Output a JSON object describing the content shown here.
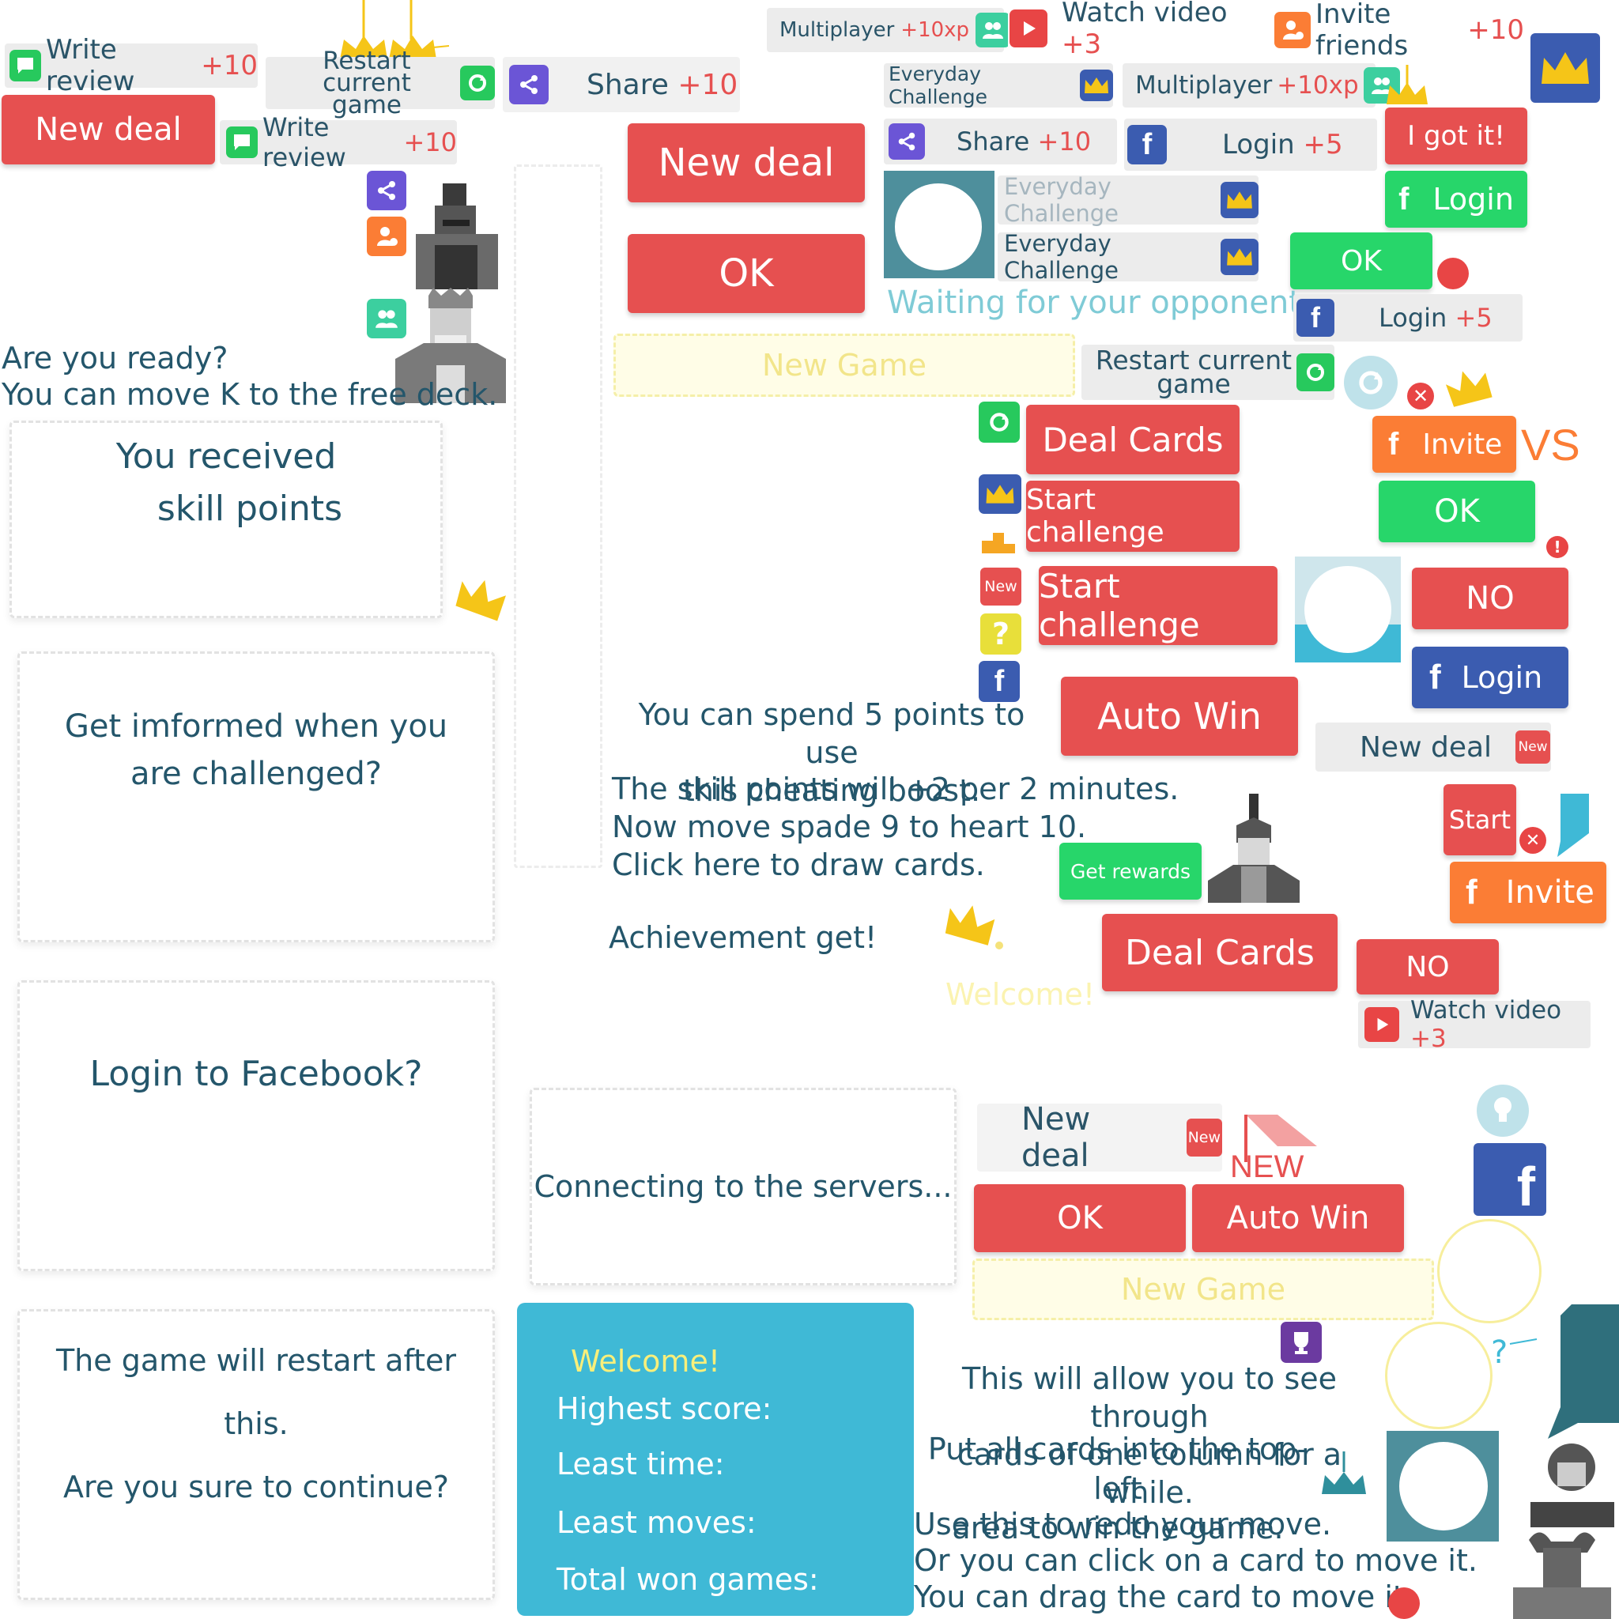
{
  "colors": {
    "red": "#e65050",
    "green": "#27d66a",
    "blue": "#3b5cb0",
    "orange": "#fb7d35",
    "teal": "#3fb9d6",
    "text": "#24566b",
    "yellow": "#f5e27a"
  },
  "rewards": {
    "write_review": "Write review",
    "write_review_plus": "+10",
    "restart_current": "Restart current",
    "restart_game": "game",
    "share": "Share",
    "share_plus": "+10",
    "multiplayer": "Multiplayer",
    "multiplayer_plus": "+10xp",
    "watch_video": "Watch video",
    "watch_plus": "+3",
    "invite_friends": "Invite friends",
    "invite_plus": "+10",
    "everyday": "Everyday Challenge",
    "login": "Login",
    "login_plus": "+5"
  },
  "buttons": {
    "new_deal": "New deal",
    "ok": "OK",
    "i_got_it": "I got it!",
    "login": "Login",
    "invite": "Invite",
    "deal_cards": "Deal Cards",
    "start_challenge": "Start challenge",
    "auto_win": "Auto Win",
    "no": "NO",
    "start": "Start",
    "get_rewards": "Get rewards",
    "new_game": "New Game",
    "new_tag": "New",
    "vs": "VS"
  },
  "messages": {
    "waiting": "Waiting for your opponent...",
    "ready_1": "Are you ready?",
    "ready_2": "You can move K to the free deck.",
    "spend_1": "You can spend 5 points to use",
    "spend_2": "this cheating boost.",
    "skill_rate": "The skill points will +2 per 2 minutes.",
    "move_spade": "Now move spade 9 to heart 10.",
    "click_draw": "Click here to draw cards.",
    "achievement": "Achievement get!",
    "welcome": "Welcome!",
    "new_badge": "NEW",
    "see_1": "This will allow you to see through",
    "see_2": "cards of one column for a while.",
    "put_1": "Put all cards into the top-left",
    "put_2": "area to win the game.",
    "redo": "Use this to redo your move.",
    "click_card": "Or you can click on a card to move it.",
    "drag_card": "You can drag the card to move it."
  },
  "dialogs": {
    "received_1": "You received",
    "received_2": "skill points",
    "informed_1": "Get imformed when you",
    "informed_2": "are challenged?",
    "login_fb": "Login to Facebook?",
    "restart_1": "The game will restart after this.",
    "restart_2": "Are you sure to continue?",
    "connecting": "Connecting to the servers..."
  },
  "stats": {
    "welcome": "Welcome!",
    "highest": "Highest score:",
    "least_time": "Least time:",
    "least_moves": "Least moves:",
    "total_won": "Total won games:"
  },
  "icons": [
    "chat-icon",
    "refresh-icon",
    "share-icon",
    "people-icon",
    "play-icon",
    "add-user-icon",
    "crown-icon",
    "facebook-icon",
    "trophy-icon",
    "bulb-icon",
    "close-icon",
    "alert-icon",
    "question-icon",
    "podium-icon"
  ]
}
